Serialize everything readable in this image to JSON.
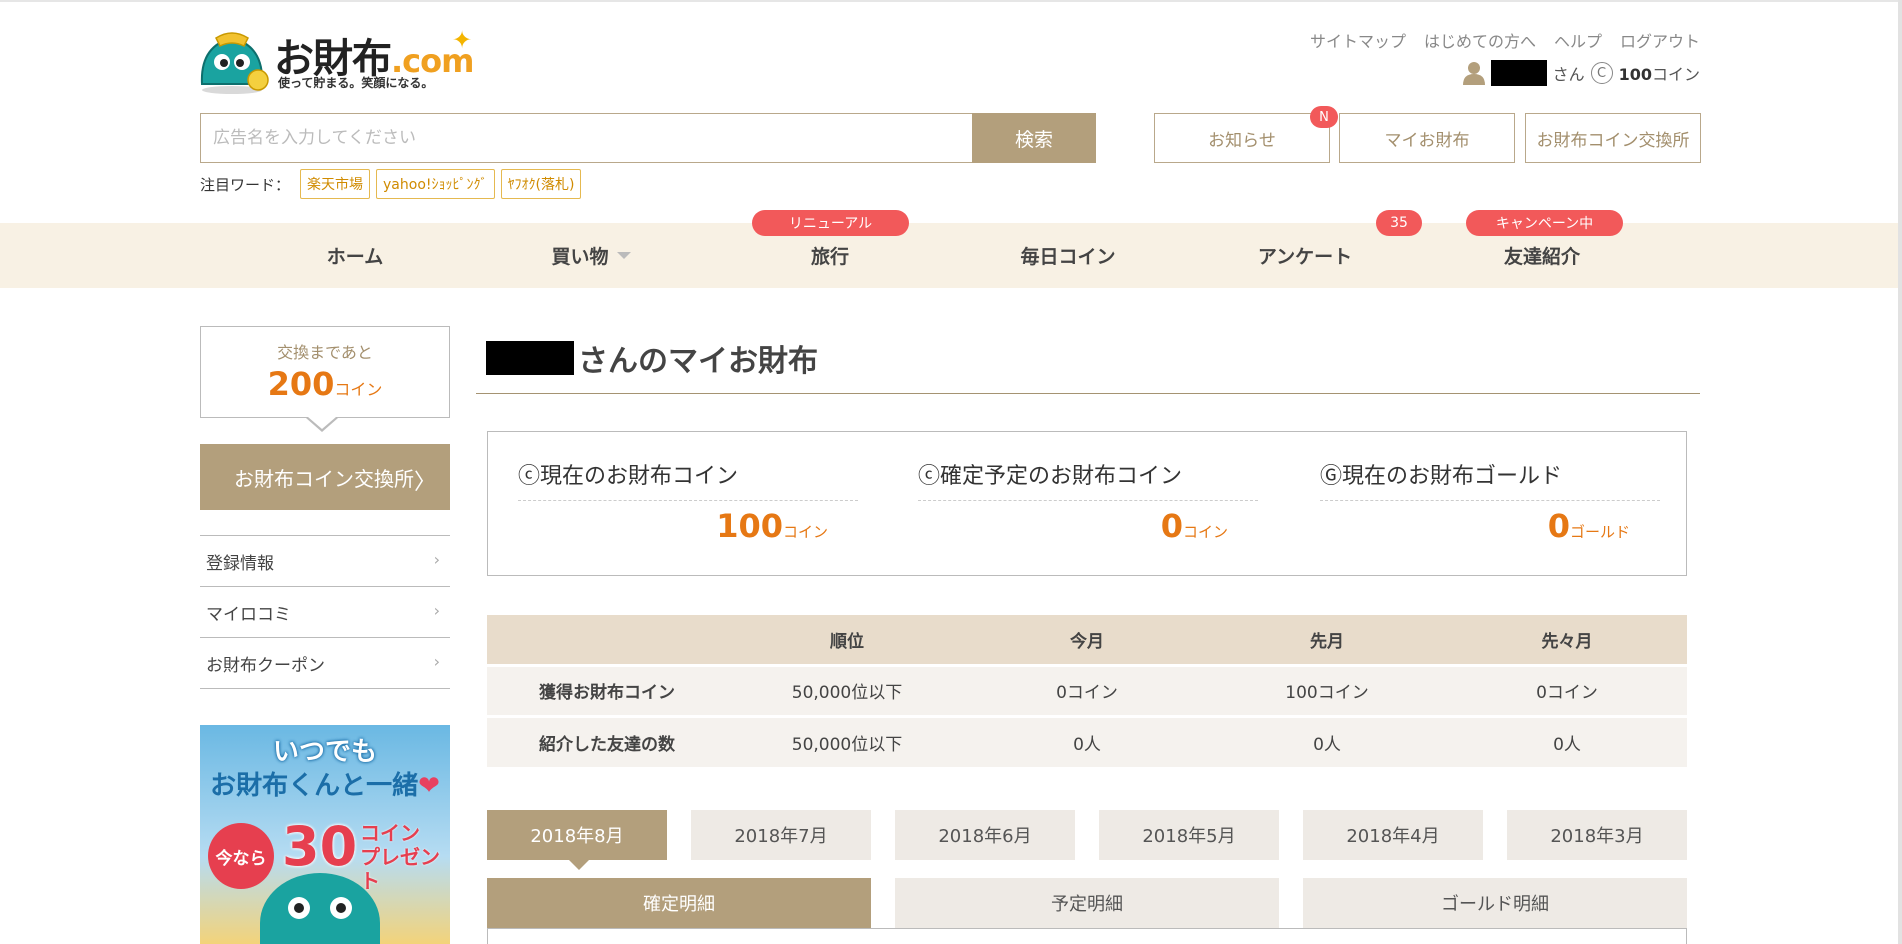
{
  "header": {
    "logo_main": "お財布",
    "logo_dot": ".com",
    "tagline": "使って貯まる。笑顔になる。",
    "links": [
      "サイトマップ",
      "はじめての方へ",
      "ヘルプ",
      "ログアウト"
    ],
    "user_suffix": "さん",
    "coin_symbol": "C",
    "coin_count": "100",
    "coin_unit": "コイン",
    "search_placeholder": "広告名を入力してください",
    "search_button": "検索",
    "hotwords_label": "注目ワード：",
    "hotwords": [
      "楽天市場",
      "yahoo!ｼｮｯﾋﾟﾝｸﾞ",
      "ﾔﾌｵｸ(落札)"
    ],
    "buttons": {
      "news": "お知らせ",
      "news_badge": "N",
      "mywallet": "マイお財布",
      "exchange": "お財布コイン交換所"
    }
  },
  "nav": {
    "items": [
      "ホーム",
      "買い物",
      "旅行",
      "毎日コイン",
      "アンケート",
      "友達紹介"
    ],
    "badges": {
      "travel": "リニューアル",
      "survey": "35",
      "friend": "キャンペーン中"
    }
  },
  "sidebar": {
    "exchange_until": "交換まであと",
    "exchange_value": "200",
    "exchange_unit": "コイン",
    "exchange_button": "お財布コイン交換所",
    "menu": [
      "登録情報",
      "マイロコミ",
      "お財布クーポン"
    ],
    "banner": {
      "line1": "いつでも",
      "line2": "お財布くんと一緒",
      "heart": "❤",
      "now": "今なら",
      "big": "30",
      "small1": "コイン",
      "small2": "プレゼント"
    }
  },
  "main": {
    "title_suffix": "さんのマイお財布",
    "coins": [
      {
        "label": "ⓒ現在のお財布コイン",
        "value": "100",
        "unit": "コイン"
      },
      {
        "label": "ⓒ確定予定のお財布コイン",
        "value": "0",
        "unit": "コイン"
      },
      {
        "label": "Ⓖ現在のお財布ゴールド",
        "value": "0",
        "unit": "ゴールド"
      }
    ],
    "ranking": {
      "headers": [
        "",
        "順位",
        "今月",
        "先月",
        "先々月"
      ],
      "rows": [
        [
          "獲得お財布コイン",
          "50,000位以下",
          "0コイン",
          "100コイン",
          "0コイン"
        ],
        [
          "紹介した友達の数",
          "50,000位以下",
          "0人",
          "0人",
          "0人"
        ]
      ]
    },
    "months": [
      "2018年8月",
      "2018年7月",
      "2018年6月",
      "2018年5月",
      "2018年4月",
      "2018年3月"
    ],
    "detail_tabs": [
      "確定明細",
      "予定明細",
      "ゴールド明細"
    ]
  },
  "colors": {
    "accent": "#b39f7c",
    "orange": "#e67814",
    "badge_red": "#f2595a",
    "nav_bg": "#f8f1e4"
  }
}
